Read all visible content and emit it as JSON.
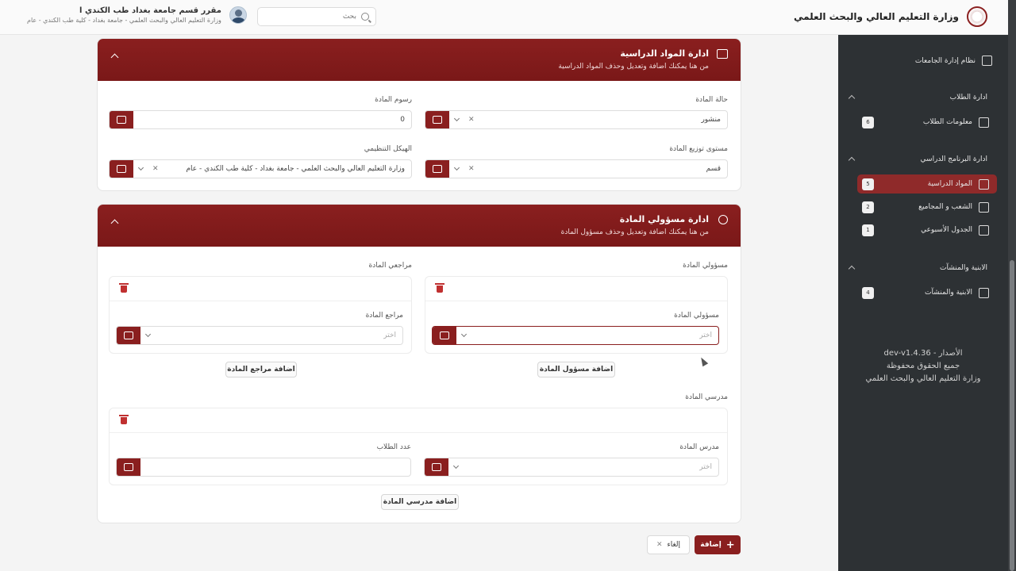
{
  "header": {
    "brand_title": "وزارة التعليم العالي والبحث العلمي",
    "search_placeholder": "بحث",
    "user_name": "مقرر قسم جامعة بغداد طب الكندي ا",
    "user_org": "وزارة التعليم العالي والبحث العلمي - جامعة بغداد - كلية طب الكندي - عام"
  },
  "sidebar": {
    "system_title": "نظام إدارة الجامعات",
    "sections": [
      {
        "label": "ادارة الطلاب",
        "items": [
          {
            "label": "معلومات الطلاب",
            "count": "6"
          }
        ]
      },
      {
        "label": "ادارة البرنامج الدراسي",
        "items": [
          {
            "label": "المواد الدراسية",
            "count": "5"
          },
          {
            "label": "الشعب و المجاميع",
            "count": "2"
          },
          {
            "label": "الجدول الأسبوعي",
            "count": "1"
          }
        ]
      },
      {
        "label": "الابنية والمنشآت",
        "items": [
          {
            "label": "الابنية والمنشآت",
            "count": "4"
          }
        ]
      }
    ],
    "footer": {
      "version": "الأصدار - dev-v1.4.36",
      "rights": "جميع الحقوق محفوظة",
      "org": "وزارة التعليم العالي والبحث العلمي"
    }
  },
  "card_materials": {
    "title": "ادارة المواد الدراسية",
    "subtitle": "من هنا يمكنك اضافة وتعديل وحذف المواد الدراسية",
    "fields": {
      "status_label": "حالة المادة",
      "status_value": "منشور",
      "fees_label": "رسوم المادة",
      "fees_value": "0",
      "distribution_label": "مستوى توزيع المادة",
      "distribution_value": "قسم",
      "org_structure_label": "الهيكل التنظيمي",
      "org_structure_value": "وزارة التعليم العالي والبحث العلمي - جامعة بغداد - كلية طب الكندي - عام"
    }
  },
  "card_officials": {
    "title": "ادارة مسؤولي المادة",
    "subtitle": "من هنا يمكنك اضافة وتعديل وحذف مسؤول المادة",
    "officials_group_label": "مسؤولي المادة",
    "official_field_label": "مسؤولي المادة",
    "official_placeholder": "اختر",
    "add_official_label": "اضافة مسؤول المادة",
    "reviewers_group_label": "مراجعي المادة",
    "reviewer_field_label": "مراجع المادة",
    "reviewer_placeholder": "اختر",
    "add_reviewer_label": "اضافة مراجع المادة",
    "teachers_group_label": "مدرسي المادة",
    "teacher_field_label": "مدرس المادة",
    "teacher_placeholder": "اختر",
    "students_count_label": "عدد الطلاب",
    "add_teacher_label": "اضافة مدرسي المادة"
  },
  "actions": {
    "submit_label": "إضافة",
    "cancel_label": "إلغاء"
  },
  "colors": {
    "primary": "#8a1f1f",
    "sidebar_bg": "#2d3134"
  }
}
